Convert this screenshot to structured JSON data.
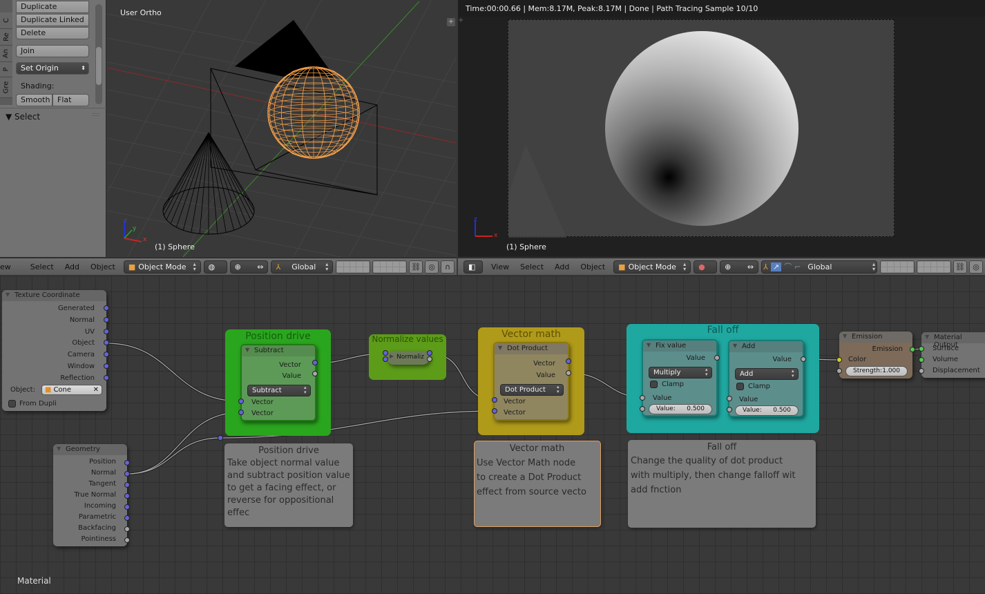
{
  "tool_panel": {
    "tabs": [
      "C",
      "Re",
      "An",
      "P",
      "Gre"
    ],
    "buttons": {
      "duplicate": "Duplicate",
      "duplicate_linked": "Duplicate Linked",
      "delete": "Delete",
      "join": "Join",
      "set_origin": "Set Origin",
      "shading_label": "Shading:",
      "smooth": "Smooth",
      "flat": "Flat"
    },
    "select_panel": "Select"
  },
  "viewport3d": {
    "view_name": "User Ortho",
    "active_object": "(1) Sphere",
    "selection_color": "#f5a04a"
  },
  "render_view": {
    "status": "Time:00:00.66 | Mem:8.17M, Peak:8.17M | Done | Path Tracing Sample 10/10",
    "active_object": "(1) Sphere"
  },
  "header_left": {
    "menus": [
      "ew",
      "Select",
      "Add",
      "Object"
    ],
    "mode": "Object Mode",
    "orientation": "Global"
  },
  "header_right": {
    "menus": [
      "View",
      "Select",
      "Add",
      "Object"
    ],
    "mode": "Object Mode",
    "orientation": "Global"
  },
  "node_editor": {
    "material_label": "Material",
    "texture_coordinate": {
      "title": "Texture Coordinate",
      "outputs": [
        "Generated",
        "Normal",
        "UV",
        "Object",
        "Camera",
        "Window",
        "Reflection"
      ],
      "object_label": "Object:",
      "object_value": "Cone",
      "from_dupli": "From Dupli"
    },
    "geometry": {
      "title": "Geometry",
      "outputs": [
        "Position",
        "Normal",
        "Tangent",
        "True Normal",
        "Incoming",
        "Parametric",
        "Backfacing",
        "Pointiness"
      ]
    },
    "frame_position": {
      "title": "Position drive",
      "color": "#2aa61e",
      "node_title": "Subtract",
      "out_vector": "Vector",
      "out_value": "Value",
      "operation": "Subtract",
      "in_vector1": "Vector",
      "in_vector2": "Vector"
    },
    "frame_normalize": {
      "title": "Normalize values",
      "color": "#5c9c18",
      "node_title": "Normaliz"
    },
    "frame_vector_math": {
      "title": "Vector math",
      "color": "#b09a1a",
      "node_title": "Dot Product",
      "out_vector": "Vector",
      "out_value": "Value",
      "operation": "Dot Product",
      "in_vector1": "Vector",
      "in_vector2": "Vector"
    },
    "frame_falloff": {
      "title": "Fall off",
      "color": "#1fa8a0",
      "fix_value": {
        "title": "Fix value",
        "out_value": "Value",
        "operation": "Multiply",
        "clamp": "Clamp",
        "in_value": "Value",
        "value_label": "Value:",
        "value": "0.500"
      },
      "add": {
        "title": "Add",
        "out_value": "Value",
        "operation": "Add",
        "clamp": "Clamp",
        "in_value": "Value",
        "value_label": "Value:",
        "value": "0.500"
      }
    },
    "emission": {
      "title": "Emission",
      "out": "Emission",
      "color_label": "Color",
      "strength_label": "Strength:",
      "strength": "1.000"
    },
    "material_output": {
      "title": "Material Output",
      "inputs": [
        "Surface",
        "Volume",
        "Displacement"
      ]
    },
    "notes": {
      "position": {
        "title": "Position drive",
        "lines": [
          "Take object normal value",
          "and subtract position value",
          "to get a facing effect, or",
          "reverse for oppositional effec"
        ]
      },
      "vector": {
        "title": "Vector math",
        "lines": [
          "Use Vector Math node",
          "to create a Dot Product",
          "effect from source vecto"
        ]
      },
      "falloff": {
        "title": "Fall off",
        "lines": [
          "Change the quality of dot product",
          "with multiply, then change falloff wit",
          "add fnction"
        ]
      }
    }
  }
}
